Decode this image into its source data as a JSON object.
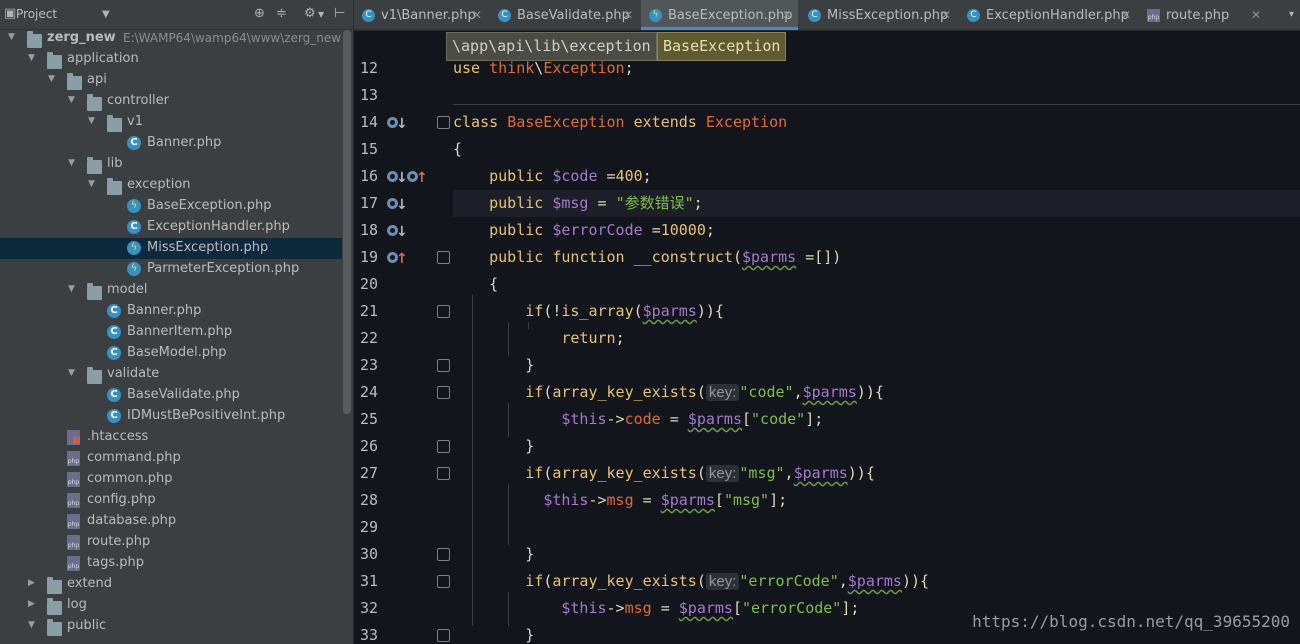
{
  "project_panel": {
    "title": "Project",
    "tree": [
      {
        "label": "zerg_new",
        "path": "E:\\WAMP64\\wamp64\\www\\zerg_new",
        "depth": 0,
        "kind": "folder",
        "expanded": true
      },
      {
        "label": "application",
        "depth": 1,
        "kind": "folder",
        "expanded": true
      },
      {
        "label": "api",
        "depth": 2,
        "kind": "folder",
        "expanded": true
      },
      {
        "label": "controller",
        "depth": 3,
        "kind": "folder",
        "expanded": true
      },
      {
        "label": "v1",
        "depth": 4,
        "kind": "folder",
        "expanded": true
      },
      {
        "label": "Banner.php",
        "depth": 5,
        "kind": "class"
      },
      {
        "label": "lib",
        "depth": 3,
        "kind": "folder",
        "expanded": true
      },
      {
        "label": "exception",
        "depth": 4,
        "kind": "folder",
        "expanded": true
      },
      {
        "label": "BaseException.php",
        "depth": 5,
        "kind": "exception"
      },
      {
        "label": "ExceptionHandler.php",
        "depth": 5,
        "kind": "class"
      },
      {
        "label": "MissException.php",
        "depth": 5,
        "kind": "exception",
        "selected": true
      },
      {
        "label": "ParmeterException.php",
        "depth": 5,
        "kind": "exception"
      },
      {
        "label": "model",
        "depth": 3,
        "kind": "folder",
        "expanded": true
      },
      {
        "label": "Banner.php",
        "depth": 4,
        "kind": "class"
      },
      {
        "label": "BannerItem.php",
        "depth": 4,
        "kind": "class"
      },
      {
        "label": "BaseModel.php",
        "depth": 4,
        "kind": "class"
      },
      {
        "label": "validate",
        "depth": 3,
        "kind": "folder",
        "expanded": true
      },
      {
        "label": "BaseValidate.php",
        "depth": 4,
        "kind": "class"
      },
      {
        "label": "IDMustBePositiveInt.php",
        "depth": 4,
        "kind": "class"
      },
      {
        "label": ".htaccess",
        "depth": 2,
        "kind": "htaccess"
      },
      {
        "label": "command.php",
        "depth": 2,
        "kind": "php"
      },
      {
        "label": "common.php",
        "depth": 2,
        "kind": "php"
      },
      {
        "label": "config.php",
        "depth": 2,
        "kind": "php"
      },
      {
        "label": "database.php",
        "depth": 2,
        "kind": "php"
      },
      {
        "label": "route.php",
        "depth": 2,
        "kind": "php"
      },
      {
        "label": "tags.php",
        "depth": 2,
        "kind": "php"
      },
      {
        "label": "extend",
        "depth": 1,
        "kind": "folder",
        "expanded": false
      },
      {
        "label": "log",
        "depth": 1,
        "kind": "folder",
        "expanded": false
      },
      {
        "label": "public",
        "depth": 1,
        "kind": "folder",
        "expanded": true
      }
    ]
  },
  "tabs": [
    {
      "label": "v1\\Banner.php",
      "icon": "class-icon",
      "active": false
    },
    {
      "label": "BaseValidate.php",
      "icon": "class-icon",
      "active": false
    },
    {
      "label": "BaseException.php",
      "icon": "exception-icon",
      "active": true
    },
    {
      "label": "MissException.php",
      "icon": "class-icon",
      "active": false
    },
    {
      "label": "ExceptionHandler.php",
      "icon": "class-icon",
      "active": false
    },
    {
      "label": "route.php",
      "icon": "php-file-icon",
      "active": false
    }
  ],
  "breadcrumb": {
    "path": "\\app\\api\\lib\\exception",
    "current": "BaseException"
  },
  "editor": {
    "current_line": 17,
    "lines": [
      {
        "n": 12,
        "tokens": [
          [
            "kw",
            "use "
          ],
          [
            "cn",
            "think"
          ],
          [
            "pl",
            "\\"
          ],
          [
            "cn",
            "Exception"
          ],
          [
            "pl",
            ";"
          ]
        ]
      },
      {
        "n": 13,
        "tokens": []
      },
      {
        "n": 14,
        "tokens": [
          [
            "kw",
            "class "
          ],
          [
            "cn",
            "BaseException "
          ],
          [
            "kw",
            "extends "
          ],
          [
            "cn",
            "Exception"
          ]
        ]
      },
      {
        "n": 15,
        "tokens": [
          [
            "pl",
            "{"
          ]
        ]
      },
      {
        "n": 16,
        "tokens": [
          [
            "pl",
            "    "
          ],
          [
            "kw",
            "public "
          ],
          [
            "vr",
            "$code "
          ],
          [
            "pl",
            "="
          ],
          [
            "nm",
            "400"
          ],
          [
            "pl",
            ";"
          ]
        ]
      },
      {
        "n": 17,
        "tokens": [
          [
            "pl",
            "    "
          ],
          [
            "kw",
            "public "
          ],
          [
            "vr",
            "$msg "
          ],
          [
            "pl",
            "= "
          ],
          [
            "st",
            "\"参数错误\""
          ],
          [
            "pl",
            ";"
          ]
        ]
      },
      {
        "n": 18,
        "tokens": [
          [
            "pl",
            "    "
          ],
          [
            "kw",
            "public "
          ],
          [
            "vr",
            "$errorCode "
          ],
          [
            "pl",
            "="
          ],
          [
            "nm",
            "10000"
          ],
          [
            "pl",
            ";"
          ]
        ]
      },
      {
        "n": 19,
        "tokens": [
          [
            "pl",
            "    "
          ],
          [
            "kw",
            "public "
          ],
          [
            "kw",
            "function "
          ],
          [
            "fn",
            "__construct"
          ],
          [
            "pl",
            "("
          ],
          [
            "vrw",
            "$parms"
          ],
          [
            "pl",
            " =[])"
          ]
        ]
      },
      {
        "n": 20,
        "tokens": [
          [
            "pl",
            "    {"
          ]
        ]
      },
      {
        "n": 21,
        "tokens": [
          [
            "pl",
            "        "
          ],
          [
            "kw",
            "if"
          ],
          [
            "pl",
            "(!"
          ],
          [
            "kw",
            "is_array"
          ],
          [
            "pl",
            "("
          ],
          [
            "vrw",
            "$parms"
          ],
          [
            "pl",
            "))"
          ],
          [
            "pl",
            "{"
          ]
        ]
      },
      {
        "n": 22,
        "tokens": [
          [
            "pl",
            "            "
          ],
          [
            "kw",
            "return"
          ],
          [
            "pl",
            ";"
          ]
        ]
      },
      {
        "n": 23,
        "tokens": [
          [
            "pl",
            "        }"
          ]
        ]
      },
      {
        "n": 24,
        "tokens": [
          [
            "pl",
            "        "
          ],
          [
            "kw",
            "if"
          ],
          [
            "pl",
            "("
          ],
          [
            "kw",
            "array_key_exists"
          ],
          [
            "pl",
            "("
          ],
          [
            "hint",
            "key:"
          ],
          [
            "st",
            "\"code\""
          ],
          [
            "pl",
            ","
          ],
          [
            "vrw",
            "$parms"
          ],
          [
            "pl",
            "))"
          ],
          [
            "pl",
            "{"
          ]
        ]
      },
      {
        "n": 25,
        "tokens": [
          [
            "pl",
            "            "
          ],
          [
            "vr",
            "$this"
          ],
          [
            "pl",
            "->"
          ],
          [
            "cn",
            "code"
          ],
          [
            "pl",
            " = "
          ],
          [
            "vrw",
            "$parms"
          ],
          [
            "pl",
            "["
          ],
          [
            "st",
            "\"code\""
          ],
          [
            "pl",
            "];"
          ]
        ]
      },
      {
        "n": 26,
        "tokens": [
          [
            "pl",
            "        }"
          ]
        ]
      },
      {
        "n": 27,
        "tokens": [
          [
            "pl",
            "        "
          ],
          [
            "kw",
            "if"
          ],
          [
            "pl",
            "("
          ],
          [
            "kw",
            "array_key_exists"
          ],
          [
            "pl",
            "("
          ],
          [
            "hint",
            "key:"
          ],
          [
            "st",
            "\"msg\""
          ],
          [
            "pl",
            ","
          ],
          [
            "vrw",
            "$parms"
          ],
          [
            "pl",
            "))"
          ],
          [
            "pl",
            "{"
          ]
        ]
      },
      {
        "n": 28,
        "tokens": [
          [
            "pl",
            "          "
          ],
          [
            "vr",
            "$this"
          ],
          [
            "pl",
            "->"
          ],
          [
            "cn",
            "msg"
          ],
          [
            "pl",
            " = "
          ],
          [
            "vrw",
            "$parms"
          ],
          [
            "pl",
            "["
          ],
          [
            "st",
            "\"msg\""
          ],
          [
            "pl",
            "];"
          ]
        ]
      },
      {
        "n": 29,
        "tokens": []
      },
      {
        "n": 30,
        "tokens": [
          [
            "pl",
            "        }"
          ]
        ]
      },
      {
        "n": 31,
        "tokens": [
          [
            "pl",
            "        "
          ],
          [
            "kw",
            "if"
          ],
          [
            "pl",
            "("
          ],
          [
            "kw",
            "array_key_exists"
          ],
          [
            "pl",
            "("
          ],
          [
            "hint",
            "key:"
          ],
          [
            "st",
            "\"errorCode\""
          ],
          [
            "pl",
            ","
          ],
          [
            "vrw",
            "$parms"
          ],
          [
            "pl",
            "))"
          ],
          [
            "pl",
            "{"
          ]
        ]
      },
      {
        "n": 32,
        "tokens": [
          [
            "pl",
            "            "
          ],
          [
            "vr",
            "$this"
          ],
          [
            "pl",
            "->"
          ],
          [
            "cn",
            "msg"
          ],
          [
            "pl",
            " = "
          ],
          [
            "vrw",
            "$parms"
          ],
          [
            "pl",
            "["
          ],
          [
            "st",
            "\"errorCode\""
          ],
          [
            "pl",
            "];"
          ]
        ]
      },
      {
        "n": 33,
        "tokens": [
          [
            "pl",
            "        }"
          ]
        ]
      }
    ]
  },
  "watermark": "https://blog.csdn.net/qq_39655200",
  "colors": {
    "panel_bg": "#3c3f41",
    "editor_bg": "#13151d",
    "selection": "#0d293e",
    "accent": "#4a88c7"
  }
}
